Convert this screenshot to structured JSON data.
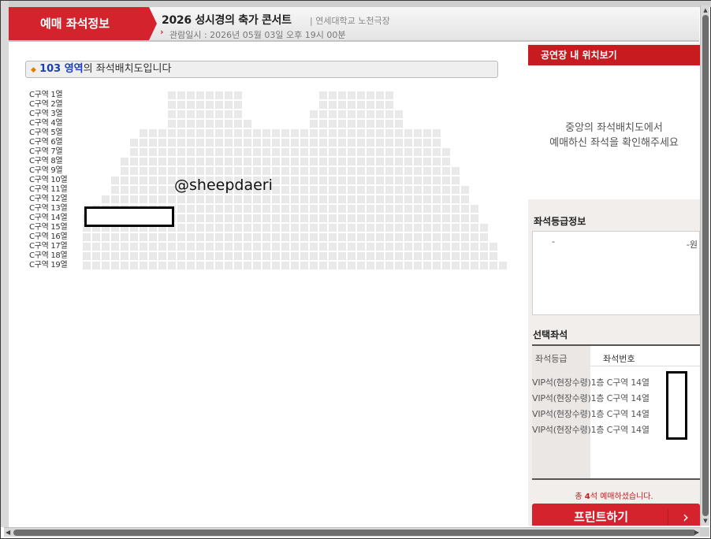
{
  "header": {
    "tab_label": "예매 좌석정보",
    "show_title": "2026 성시경의 축가 콘서트",
    "venue": "| 연세대학교 노천극장",
    "date_arrow": "›",
    "show_date": "관람일시 : 2026년 05월 03일 오후 19시 00분"
  },
  "seat_map": {
    "zone_bullet": "◆",
    "zone_name": "103 영역",
    "zone_suffix": "의 좌석배치도입니다",
    "row_labels": [
      "C구역 1열",
      "C구역 2열",
      "C구역 3열",
      "C구역 4열",
      "C구역 5열",
      "C구역 6열",
      "C구역 7열",
      "C구역 8열",
      "C구역 9열",
      "C구역 10열",
      "C구역 11열",
      "C구역 12열",
      "C구역 13열",
      "C구역 14열",
      "C구역 15열",
      "C구역 16열",
      "C구역 17열",
      "C구역 18열",
      "C구역 19열"
    ],
    "watermark": "@sheepdaeri"
  },
  "location_panel": {
    "title": "공연장 내 위치보기",
    "message_line1": "중앙의 좌석배치도에서",
    "message_line2": "예매하신 좌석을 확인해주세요"
  },
  "grade_info": {
    "title": "좌석등급정보",
    "grade_name": "-",
    "grade_price": "-원"
  },
  "selected": {
    "title": "선택좌석",
    "col_grade": "좌석등급",
    "col_seat": "좌석번호",
    "rows": [
      "VIP석(현장수령)1층 C구역 14열",
      "VIP석(현장수령)1층 C구역 14열",
      "VIP석(현장수령)1층 C구역 14열",
      "VIP석(현장수령)1층 C구역 14열"
    ],
    "total_prefix": "총 ",
    "total_count": "4",
    "total_suffix": "석 예매하셨습니다.",
    "print_label": "프린트하기",
    "print_arrow": "›"
  },
  "scrollbars": {
    "up": "▲",
    "down": "▼",
    "left": "◀",
    "right": "▶"
  },
  "colors": {
    "accent": "#d4232c",
    "seat": "#e9e9e9",
    "zone_name": "#1a3fb8"
  }
}
